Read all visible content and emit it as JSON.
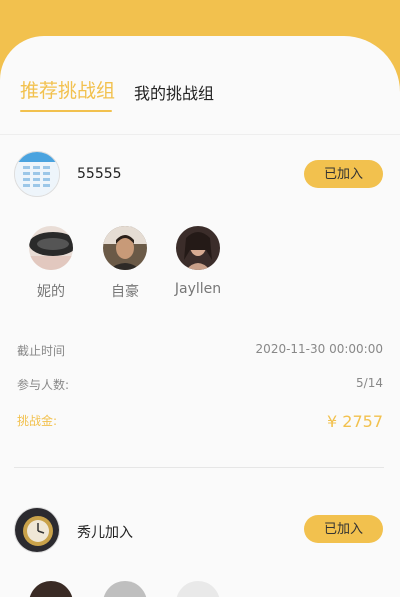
{
  "colors": {
    "accent": "#f2c14e",
    "background": "#fafafa"
  },
  "tabs": [
    {
      "label": "推荐挑战组",
      "active": true
    },
    {
      "label": "我的挑战组",
      "active": false
    }
  ],
  "groups": [
    {
      "name": "55555",
      "button_label": "已加入",
      "avatar_icon": "spreadsheet-thumbnail-icon",
      "members": [
        {
          "name": "妮的",
          "avatar_icon": "dark-car-photo-avatar"
        },
        {
          "name": "自豪",
          "avatar_icon": "man-portrait-avatar"
        },
        {
          "name": "Jayllen",
          "avatar_icon": "woman-portrait-avatar"
        }
      ],
      "deadline_label": "截止时间",
      "deadline_value": "2020-11-30 00:00:00",
      "participants_label": "参与人数:",
      "participants_value": "5/14",
      "prize_label": "挑战金:",
      "prize_value": "¥ 2757"
    },
    {
      "name": "秀儿加入",
      "button_label": "已加入",
      "avatar_icon": "gold-watch-photo-avatar",
      "members": []
    }
  ]
}
